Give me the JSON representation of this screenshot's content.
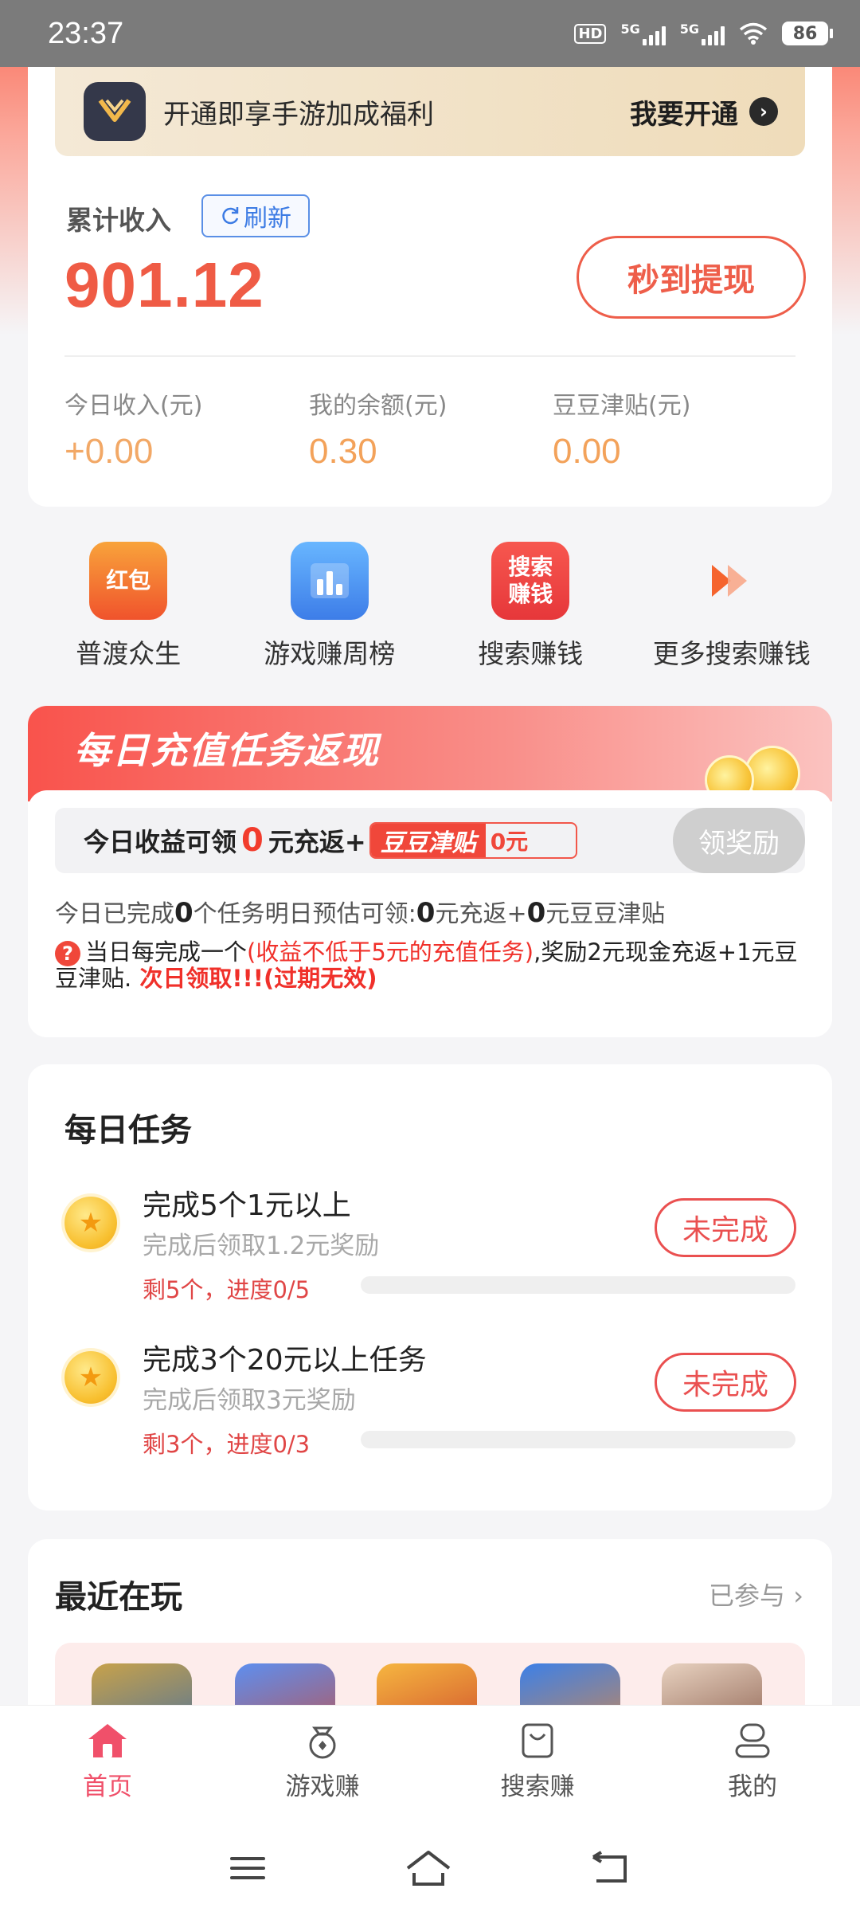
{
  "status_bar": {
    "time": "23:37",
    "network_hd": "HD",
    "network_1": "5G",
    "network_2": "5G",
    "battery": "86"
  },
  "vip_banner": {
    "text": "开通即享手游加成福利",
    "action": "我要开通"
  },
  "income": {
    "label": "累计收入",
    "refresh": "刷新",
    "total": "901.12",
    "withdraw": "秒到提现",
    "stats": [
      {
        "label": "今日收入(元)",
        "value": "+0.00"
      },
      {
        "label": "我的余额(元)",
        "value": "0.30"
      },
      {
        "label": "豆豆津贴(元)",
        "value": "0.00"
      }
    ]
  },
  "shortcuts": [
    {
      "label": "普渡众生",
      "icon_text": "红包",
      "icon": "red-packet-icon"
    },
    {
      "label": "游戏赚周榜",
      "icon": "bar-chart-icon"
    },
    {
      "label": "搜索赚钱",
      "icon_text": "搜索赚钱",
      "icon": "search-earn-icon"
    },
    {
      "label": "更多搜索赚钱",
      "icon": "double-arrow-icon"
    }
  ],
  "recharge_task": {
    "title": "每日充值任务返现",
    "claim_prefix": "今日收益可领",
    "claim_amount": "0",
    "claim_suffix": "元充返+",
    "subsidy_tag": "豆豆津贴",
    "subsidy_amount": "0元",
    "claim_button": "领奖励",
    "progress_a": "今日已完成",
    "progress_b": "0",
    "progress_c": "个任务明日预估可领:",
    "progress_d": "0",
    "progress_e": "元充返+",
    "progress_f": "0",
    "progress_g": "元豆豆津贴",
    "rule_a": "当日每完成一个",
    "rule_b": "(收益不低于5元的充值任务)",
    "rule_c": ",奖励2元现金充返+1元豆豆津贴.",
    "rule_d": " 次日领取!!!(过期无效)"
  },
  "daily_tasks": {
    "title": "每日任务",
    "items": [
      {
        "title": "完成5个1元以上",
        "sub": "完成后领取1.2元奖励",
        "progress": "剩5个，进度0/5",
        "progress_fraction": 0,
        "status": "未完成"
      },
      {
        "title": "完成3个20元以上任务",
        "sub": "完成后领取3元奖励",
        "progress": "剩3个，进度0/3",
        "progress_fraction": 0,
        "status": "未完成"
      }
    ]
  },
  "recent": {
    "title": "最近在玩",
    "more": "已参与"
  },
  "bottom_nav": [
    {
      "label": "首页",
      "icon": "home-icon",
      "active": true
    },
    {
      "label": "游戏赚",
      "icon": "game-bag-icon",
      "active": false
    },
    {
      "label": "搜索赚",
      "icon": "shopping-bag-icon",
      "active": false
    },
    {
      "label": "我的",
      "icon": "profile-icon",
      "active": false
    }
  ],
  "colors": {
    "accent_red": "#ef5b45",
    "orange_value": "#f3a25a",
    "nav_active": "#f0506a"
  }
}
